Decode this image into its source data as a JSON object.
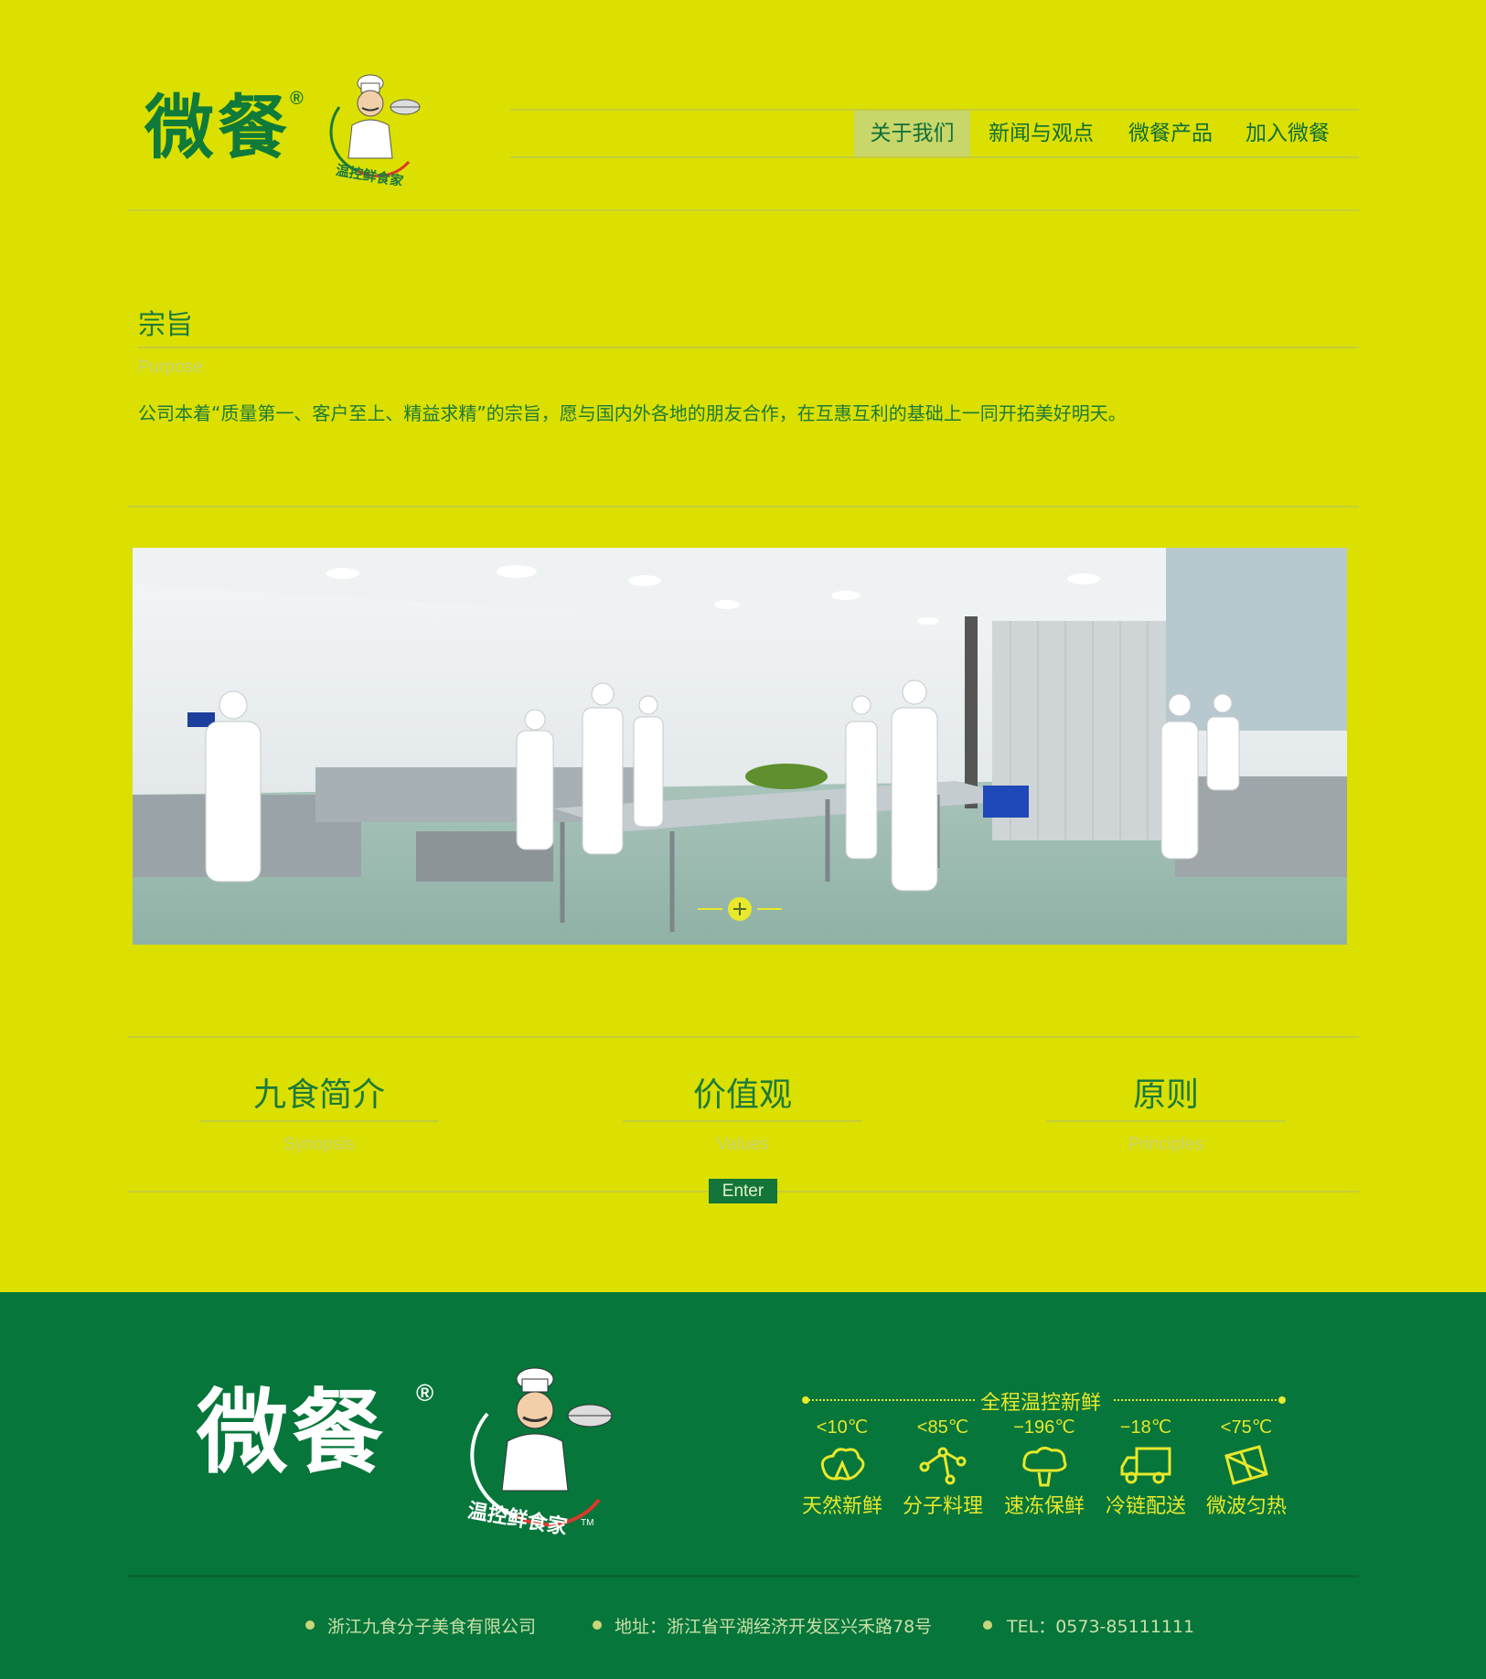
{
  "header": {
    "logo_text": "微餐",
    "logo_reg": "®",
    "logo_mascot_text": "温控鲜食家",
    "nav": [
      {
        "label": "关于我们",
        "active": true
      },
      {
        "label": "新闻与观点",
        "active": false
      },
      {
        "label": "微餐产品",
        "active": false
      },
      {
        "label": "加入微餐",
        "active": false
      }
    ]
  },
  "purpose": {
    "title": "宗旨",
    "subtitle": "Purpose",
    "text": "公司本着“质量第一、客户至上、精益求精”的宗旨，愿与国内外各地的朋友合作，在互惠互利的基础上一同开拓美好明天。"
  },
  "cards": [
    {
      "title": "九食简介",
      "subtitle": "Synopsis"
    },
    {
      "title": "价值观",
      "subtitle": "Values"
    },
    {
      "title": "原则",
      "subtitle": "Principles"
    }
  ],
  "enter_label": "Enter",
  "footer": {
    "logo_text": "微餐",
    "logo_reg": "®",
    "logo_mascot_text": "温控鲜食家",
    "mascot_tm": "TM",
    "tagline": "全程温控新鲜",
    "features": [
      {
        "temp": "<10℃",
        "label": "天然新鲜",
        "icon": "vegetable-icon"
      },
      {
        "temp": "<85℃",
        "label": "分子料理",
        "icon": "molecule-icon"
      },
      {
        "temp": "−196℃",
        "label": "速冻保鲜",
        "icon": "broccoli-icon"
      },
      {
        "temp": "−18℃",
        "label": "冷链配送",
        "icon": "truck-icon"
      },
      {
        "temp": "<75℃",
        "label": "微波匀热",
        "icon": "microwave-icon"
      }
    ],
    "contacts": [
      {
        "text": "浙江九食分子美食有限公司"
      },
      {
        "text": "地址：浙江省平湖经济开发区兴禾路78号"
      },
      {
        "text": "TEL：0573-85111111"
      }
    ]
  },
  "colors": {
    "background": "#dbe000",
    "brand_green": "#0f7a3a",
    "footer_green": "#06763b",
    "accent_yellow": "#e8e82c"
  }
}
